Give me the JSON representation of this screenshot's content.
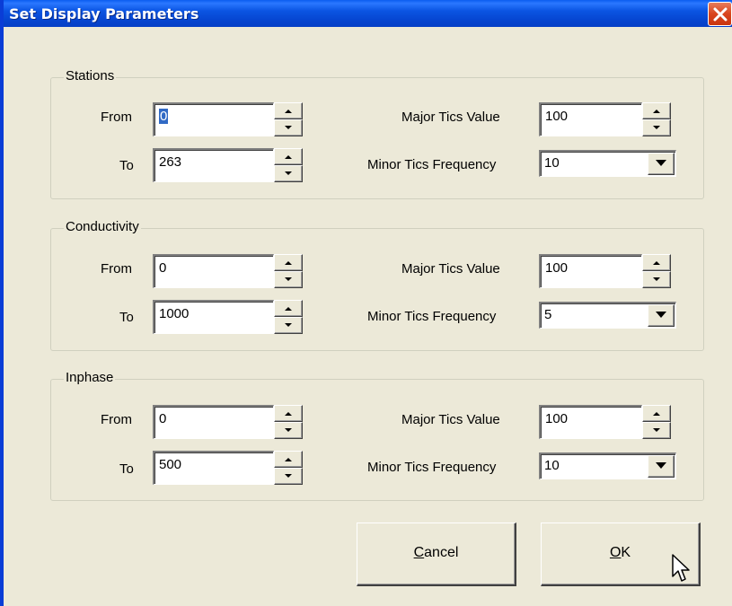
{
  "window": {
    "title": "Set Display Parameters"
  },
  "labels": {
    "from": "From",
    "to": "To",
    "major_tics": "Major Tics Value",
    "minor_tics": "Minor Tics Frequency"
  },
  "groups": [
    {
      "title": "Stations",
      "from": "0",
      "to": "263",
      "major": "100",
      "minor": "10"
    },
    {
      "title": "Conductivity",
      "from": "0",
      "to": "1000",
      "major": "100",
      "minor": "5"
    },
    {
      "title": "Inphase",
      "from": "0",
      "to": "500",
      "major": "100",
      "minor": "10"
    }
  ],
  "buttons": {
    "cancel_accel": "C",
    "cancel_rest": "ancel",
    "ok_accel": "O",
    "ok_rest": "K"
  },
  "icons": {
    "close": "close-icon",
    "spin_up": "spin-up-arrow-icon",
    "spin_down": "spin-down-arrow-icon",
    "dropdown": "chevron-down-icon",
    "cursor": "mouse-pointer-icon"
  }
}
